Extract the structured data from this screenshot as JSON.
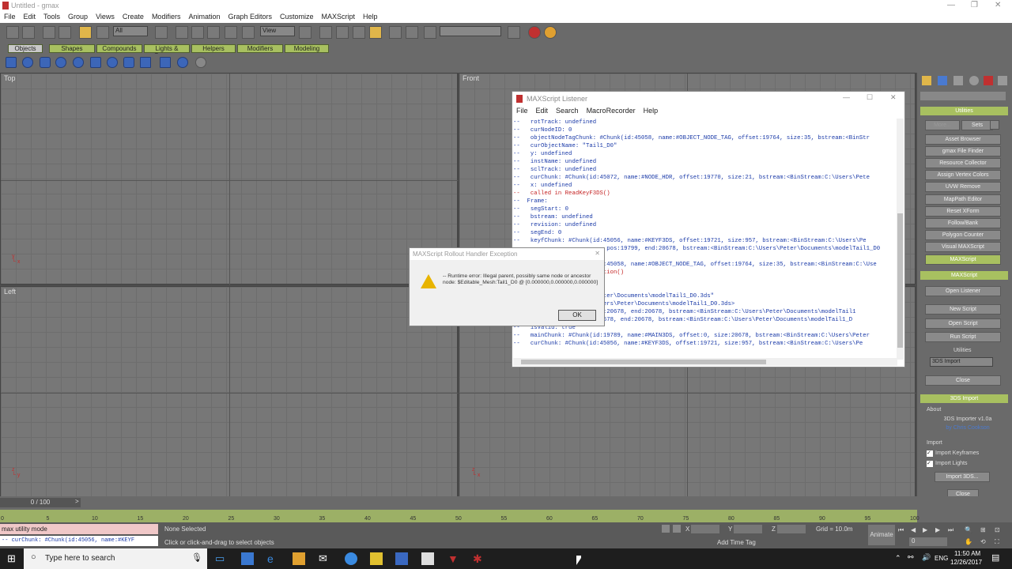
{
  "window": {
    "title": "Untitled - gmax"
  },
  "menu": [
    "File",
    "Edit",
    "Tools",
    "Group",
    "Views",
    "Create",
    "Modifiers",
    "Animation",
    "Graph Editors",
    "Customize",
    "MAXScript",
    "Help"
  ],
  "toolbar": {
    "selection_filter": "All",
    "ref_coord": "View"
  },
  "tabs": [
    "Objects",
    "Shapes",
    "Compounds",
    "Lights & Cameras",
    "Helpers",
    "Modifiers",
    "Modeling"
  ],
  "viewports": {
    "top": "Top",
    "front": "Front",
    "left": "Left"
  },
  "listener": {
    "title": "MAXScript Listener",
    "menu": [
      "File",
      "Edit",
      "Search",
      "MacroRecorder",
      "Help"
    ],
    "lines": [
      {
        "t": "--   rotTrack: undefined",
        "c": "b"
      },
      {
        "t": "--   curNodeID: 0",
        "c": "b"
      },
      {
        "t": "--   objectNodeTagChunk: #Chunk(id:45058, name:#OBJECT_NODE_TAG, offset:19764, size:35, bstream:<BinStr",
        "c": "b"
      },
      {
        "t": "--   curObjectName: \"Tail1_D0\"",
        "c": "b"
      },
      {
        "t": "--   y: undefined",
        "c": "b"
      },
      {
        "t": "--   instName: undefined",
        "c": "b"
      },
      {
        "t": "--   sclTrack: undefined",
        "c": "b"
      },
      {
        "t": "--   curChunk: #Chunk(id:45072, name:#NODE_HDR, offset:19770, size:21, bstream:<BinStream:C:\\Users\\Pete",
        "c": "b"
      },
      {
        "t": "--   x: undefined",
        "c": "b"
      },
      {
        "t": "--   called in ReadKeyF3DS()",
        "c": "r"
      },
      {
        "t": "--  Frame:",
        "c": "b"
      },
      {
        "t": "--   segStart: 0",
        "c": "b"
      },
      {
        "t": "--   bstream: undefined",
        "c": "b"
      },
      {
        "t": "--   revision: undefined",
        "c": "b"
      },
      {
        "t": "--   segEnd: 0",
        "c": "b"
      },
      {
        "t": "--   keyfChunk: #Chunk(id:45056, name:#KEYF3DS, offset:19721, size:957, bstream:<BinStream:C:\\Users\\Pe",
        "c": "b"
      },
      {
        "t": "--                         pos:19799, end:20678, bstream:<BinStream:C:\\Users\\Peter\\Documents\\modelTail1_D0",
        "c": "b"
      },
      {
        "t": "",
        "c": "b"
      },
      {
        "t": "--                        :45058, name:#OBJECT_NODE_TAG, offset:19764, size:35, bstream:<BinStream:C:\\Use",
        "c": "b"
      },
      {
        "t": "--                        tion()",
        "c": "r"
      },
      {
        "t": "",
        "c": "b"
      },
      {
        "t": "",
        "c": "b"
      },
      {
        "t": "--                  ers\\Peter\\Documents\\modelTail1_D0.3ds\"",
        "c": "b"
      },
      {
        "t": "--                  :C:\\Users\\Peter\\Documents\\modelTail1_D0.3ds>",
        "c": "b"
      },
      {
        "t": "--                  er(pos:20678, end:20678, bstream:<BinStream:C:\\Users\\Peter\\Documents\\modelTail1",
        "c": "b"
      },
      {
        "t": "--                  pos:20678, end:20678, bstream:<BinStream:C:\\Users\\Peter\\Documents\\modelTail1_D",
        "c": "b"
      },
      {
        "t": "--   isValid: true",
        "c": "b"
      },
      {
        "t": "--   mainChunk: #Chunk(id:19789, name:#MAIN3DS, offset:0, size:20678, bstream:<BinStream:C:\\Users\\Peter",
        "c": "b"
      },
      {
        "t": "--   curChunk: #Chunk(id:45056, name:#KEYF3DS, offset:19721, size:957, bstream:<BinStream:C:\\Users\\Pe",
        "c": "b"
      }
    ]
  },
  "dialog": {
    "title": "MAXScript Rollout Handler Exception",
    "message": "-- Runtime error: Illegal parent, possibly same node or ancestor node: $Editable_Mesh:Tail1_D0 @ [0.000000,0.000000,0.000000]",
    "ok": "OK"
  },
  "utilities": {
    "header": "Utilities",
    "more": "More...",
    "sets": "Sets",
    "buttons": [
      "Asset Browser",
      "gmax File Finder",
      "Resource Collector",
      "Assign Vertex Colors",
      "UVW Remove",
      "MapPath Editor",
      "Reset XForm",
      "Follow/Bank",
      "Polygon Counter",
      "Visual MAXScript",
      "MAXScript"
    ],
    "maxscript_header": "MAXScript",
    "ms_buttons": [
      "Open Listener",
      "New Script",
      "Open Script",
      "Run Script"
    ],
    "utilities_label": "Utilities",
    "dropdown": "3DS Import",
    "close": "Close",
    "import_header": "3DS Import",
    "about": "About",
    "importer_name": "3DS Importer v1.0a",
    "author": "by Chris Cookson",
    "import_label": "Import",
    "import_keyframes": "Import Keyframes",
    "import_lights": "Import Lights",
    "import_button": "Import 3DS...",
    "close2": "Close"
  },
  "timeline": {
    "frame": "0 / 100",
    "ticks": [
      "0",
      "5",
      "10",
      "15",
      "20",
      "25",
      "30",
      "35",
      "40",
      "45",
      "50",
      "55",
      "60",
      "65",
      "70",
      "75",
      "80",
      "85",
      "90",
      "95",
      "100"
    ]
  },
  "status": {
    "mode": "max utility mode",
    "listener_line": "--   curChunk: #Chunk(id:45056, name:#KEYF",
    "selection": "None Selected",
    "hint": "Click or click-and-drag to select objects",
    "x": "X",
    "y": "Y",
    "z": "Z",
    "grid": "Grid = 10.0m",
    "add_time_tag": "Add Time Tag",
    "animate": "Animate",
    "frame_field": "0"
  },
  "taskbar": {
    "search": "Type here to search",
    "lang": "ENG",
    "time": "11:50 AM",
    "date": "12/26/2017"
  }
}
